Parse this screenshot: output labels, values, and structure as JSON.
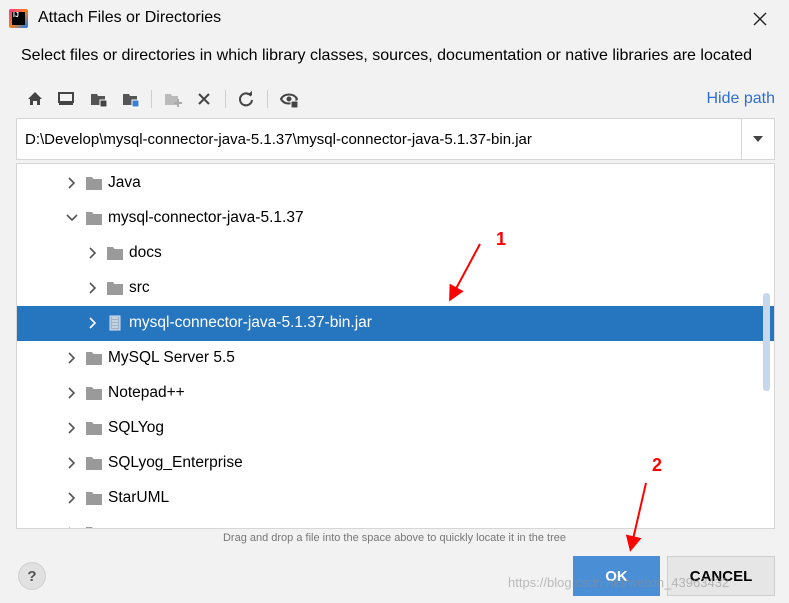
{
  "window": {
    "title": "Attach Files or Directories",
    "subtitle": "Select files or directories in which library classes, sources, documentation or native libraries are located"
  },
  "toolbar": {
    "buttons": [
      {
        "icon": "home-icon"
      },
      {
        "icon": "desktop-icon"
      },
      {
        "icon": "project-folder-icon"
      },
      {
        "icon": "module-folder-icon"
      },
      {
        "icon": "new-folder-icon",
        "enabled": false
      },
      {
        "icon": "delete-icon"
      },
      {
        "icon": "refresh-icon"
      },
      {
        "icon": "show-hidden-icon"
      }
    ],
    "hide_path_label": "Hide path"
  },
  "path": {
    "value": "D:\\Develop\\mysql-connector-java-5.1.37\\mysql-connector-java-5.1.37-bin.jar"
  },
  "tree": {
    "rows": [
      {
        "label": "Java",
        "level": 0,
        "expanded": false,
        "type": "folder",
        "selected": false
      },
      {
        "label": "mysql-connector-java-5.1.37",
        "level": 0,
        "expanded": true,
        "type": "folder",
        "selected": false
      },
      {
        "label": "docs",
        "level": 1,
        "expanded": false,
        "type": "folder",
        "selected": false
      },
      {
        "label": "src",
        "level": 1,
        "expanded": false,
        "type": "folder",
        "selected": false
      },
      {
        "label": "mysql-connector-java-5.1.37-bin.jar",
        "level": 1,
        "expanded": false,
        "type": "jar",
        "selected": true
      },
      {
        "label": "MySQL Server 5.5",
        "level": 0,
        "expanded": false,
        "type": "folder",
        "selected": false
      },
      {
        "label": "Notepad++",
        "level": 0,
        "expanded": false,
        "type": "folder",
        "selected": false
      },
      {
        "label": "SQLYog",
        "level": 0,
        "expanded": false,
        "type": "folder",
        "selected": false
      },
      {
        "label": "SQLyog_Enterprise",
        "level": 0,
        "expanded": false,
        "type": "folder",
        "selected": false
      },
      {
        "label": "StarUML",
        "level": 0,
        "expanded": false,
        "type": "folder",
        "selected": false
      }
    ]
  },
  "hint": "Drag and drop a file into the space above to quickly locate it in the tree",
  "buttons": {
    "help": "?",
    "ok": "OK",
    "cancel": "CANCEL"
  },
  "annotations": {
    "first": "1",
    "second": "2",
    "color": "#ff0000"
  },
  "watermark": "https://blog.csdn.net/weixin_43963432",
  "colors": {
    "selection": "#2675bf",
    "link": "#2f6fd1",
    "ok_button": "#4a8fd6"
  }
}
